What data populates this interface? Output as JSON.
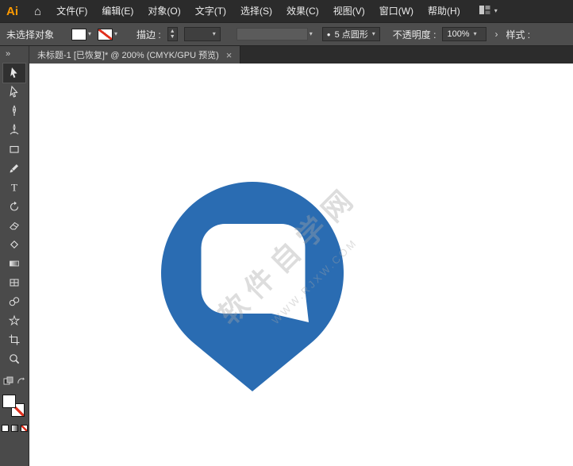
{
  "menubar": {
    "logo": "Ai",
    "items": [
      {
        "label": "文件(F)"
      },
      {
        "label": "编辑(E)"
      },
      {
        "label": "对象(O)"
      },
      {
        "label": "文字(T)"
      },
      {
        "label": "选择(S)"
      },
      {
        "label": "效果(C)"
      },
      {
        "label": "视图(V)"
      },
      {
        "label": "窗口(W)"
      },
      {
        "label": "帮助(H)"
      }
    ]
  },
  "control_bar": {
    "selection_status": "未选择对象",
    "stroke_label": "描边 :",
    "brush_bullet": "●",
    "brush_value": "5 点圆形",
    "opacity_label": "不透明度 :",
    "opacity_value": "100%",
    "style_label": "样式 :"
  },
  "tabbar": {
    "expand_icon": "»",
    "tab_title": "未标题-1 [已恢复]* @ 200% (CMYK/GPU 预览)",
    "close_icon": "×"
  },
  "toolbar": {
    "tools": [
      "selection",
      "direct-selection",
      "pen",
      "curvature",
      "rectangle",
      "paintbrush",
      "type",
      "rotate",
      "eraser",
      "shaper",
      "gradient",
      "mesh",
      "blend",
      "symbol-sprayer",
      "artboard",
      "zoom"
    ]
  },
  "canvas": {
    "watermark_line1": "软件自学网",
    "watermark_line2": "WWW.RJXW.COM"
  },
  "colors": {
    "pin_blue": "#2a6cb2",
    "logo_orange": "#ff9a00",
    "none_red": "#e0301e"
  }
}
